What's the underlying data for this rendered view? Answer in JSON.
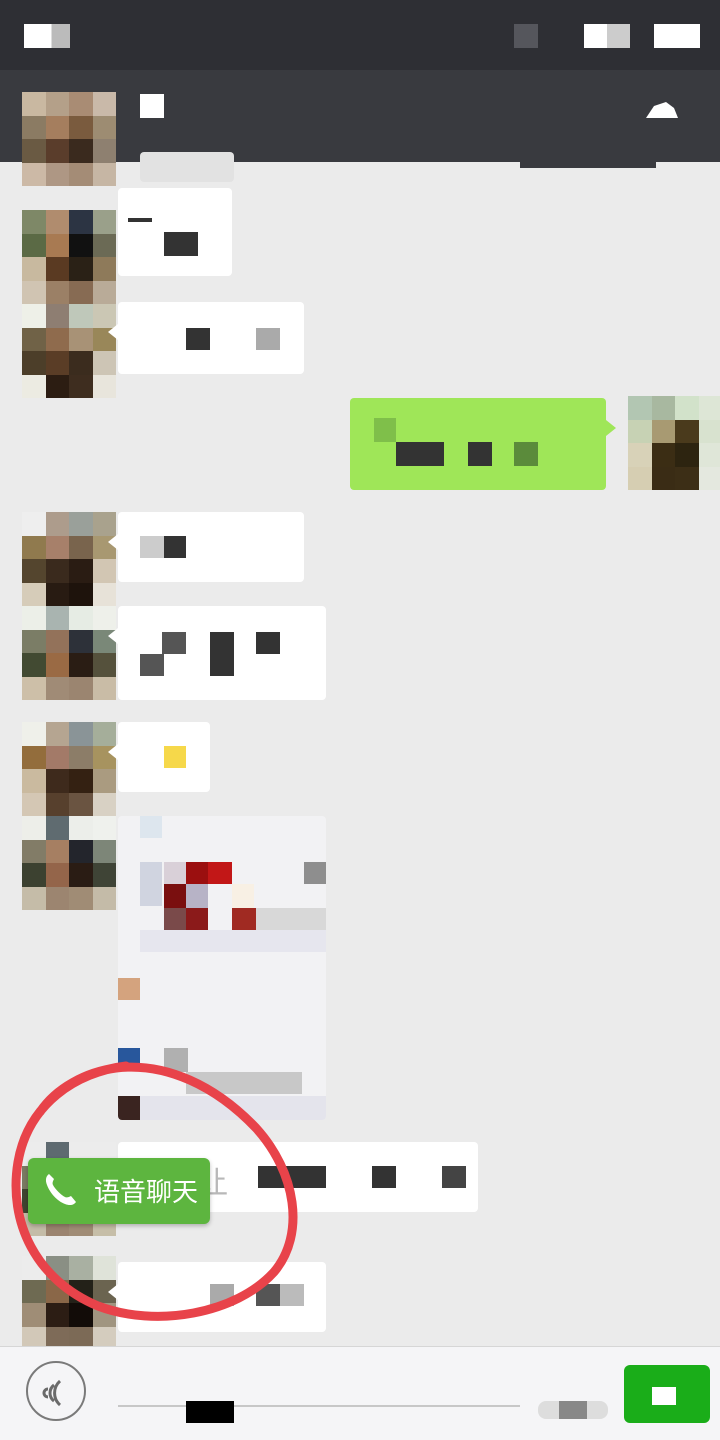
{
  "colors": {
    "status_bar": "#2e2f34",
    "nav_bar": "#393a3f",
    "chat_bg": "#ebebeb",
    "bubble_in": "#ffffff",
    "bubble_out": "#9fe658",
    "voice_chip": "#5db53f",
    "annotation": "#e8434a",
    "send_button": "#1aad19"
  },
  "chat": {
    "messages": [
      {
        "direction": "incoming",
        "content": "pixelated"
      },
      {
        "direction": "incoming",
        "content": "pixelated"
      },
      {
        "direction": "outgoing",
        "content": "pixelated"
      },
      {
        "direction": "incoming",
        "content": "pixelated"
      },
      {
        "direction": "incoming",
        "content": "pixelated"
      },
      {
        "direction": "incoming",
        "content": "pixelated"
      },
      {
        "direction": "incoming",
        "content": "image"
      },
      {
        "direction": "incoming",
        "text": "最后让"
      },
      {
        "direction": "incoming",
        "content": "pixelated"
      }
    ]
  },
  "voice_chat": {
    "label": "语音聊天",
    "icon": "phone-icon"
  },
  "icons": {
    "back": "back-arrow-icon",
    "more": "profile-icon",
    "voice_toggle": "voice-icon",
    "send": "send-icon"
  }
}
